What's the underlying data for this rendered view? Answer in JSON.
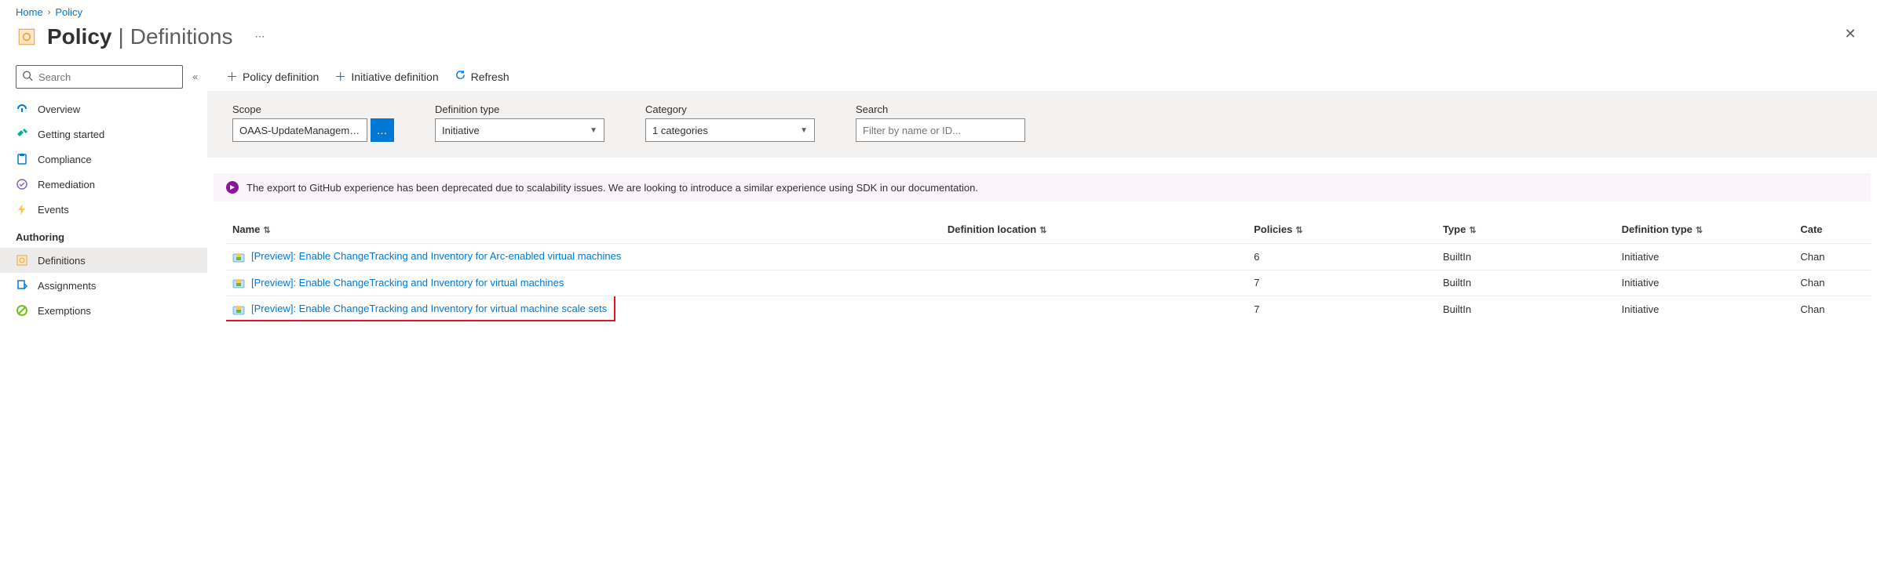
{
  "breadcrumb": {
    "home": "Home",
    "policy": "Policy"
  },
  "header": {
    "title": "Policy",
    "subtitle": "Definitions"
  },
  "sidebar": {
    "search_placeholder": "Search",
    "items": [
      {
        "id": "overview",
        "label": "Overview"
      },
      {
        "id": "getting-started",
        "label": "Getting started"
      },
      {
        "id": "compliance",
        "label": "Compliance"
      },
      {
        "id": "remediation",
        "label": "Remediation"
      },
      {
        "id": "events",
        "label": "Events"
      }
    ],
    "authoring_section": "Authoring",
    "authoring_items": [
      {
        "id": "definitions",
        "label": "Definitions"
      },
      {
        "id": "assignments",
        "label": "Assignments"
      },
      {
        "id": "exemptions",
        "label": "Exemptions"
      }
    ]
  },
  "toolbar": {
    "policy_definition": "Policy definition",
    "initiative_definition": "Initiative definition",
    "refresh": "Refresh"
  },
  "filters": {
    "scope_label": "Scope",
    "scope_value": "OAAS-UpdateManagem…",
    "def_type_label": "Definition type",
    "def_type_value": "Initiative",
    "category_label": "Category",
    "category_value": "1 categories",
    "search_label": "Search",
    "search_placeholder": "Filter by name or ID..."
  },
  "banner": {
    "text": "The export to GitHub experience has been deprecated due to scalability issues. We are looking to introduce a similar experience using SDK in our documentation."
  },
  "table": {
    "columns": {
      "name": "Name",
      "location": "Definition location",
      "policies": "Policies",
      "type": "Type",
      "def_type": "Definition type",
      "category": "Cate"
    },
    "rows": [
      {
        "name": "[Preview]: Enable ChangeTracking and Inventory for Arc-enabled virtual machines",
        "location": "",
        "policies": "6",
        "type": "BuiltIn",
        "def_type": "Initiative",
        "category": "Chan",
        "highlight": false
      },
      {
        "name": "[Preview]: Enable ChangeTracking and Inventory for virtual machines",
        "location": "",
        "policies": "7",
        "type": "BuiltIn",
        "def_type": "Initiative",
        "category": "Chan",
        "highlight": false
      },
      {
        "name": "[Preview]: Enable ChangeTracking and Inventory for virtual machine scale sets",
        "location": "",
        "policies": "7",
        "type": "BuiltIn",
        "def_type": "Initiative",
        "category": "Chan",
        "highlight": true
      }
    ]
  }
}
